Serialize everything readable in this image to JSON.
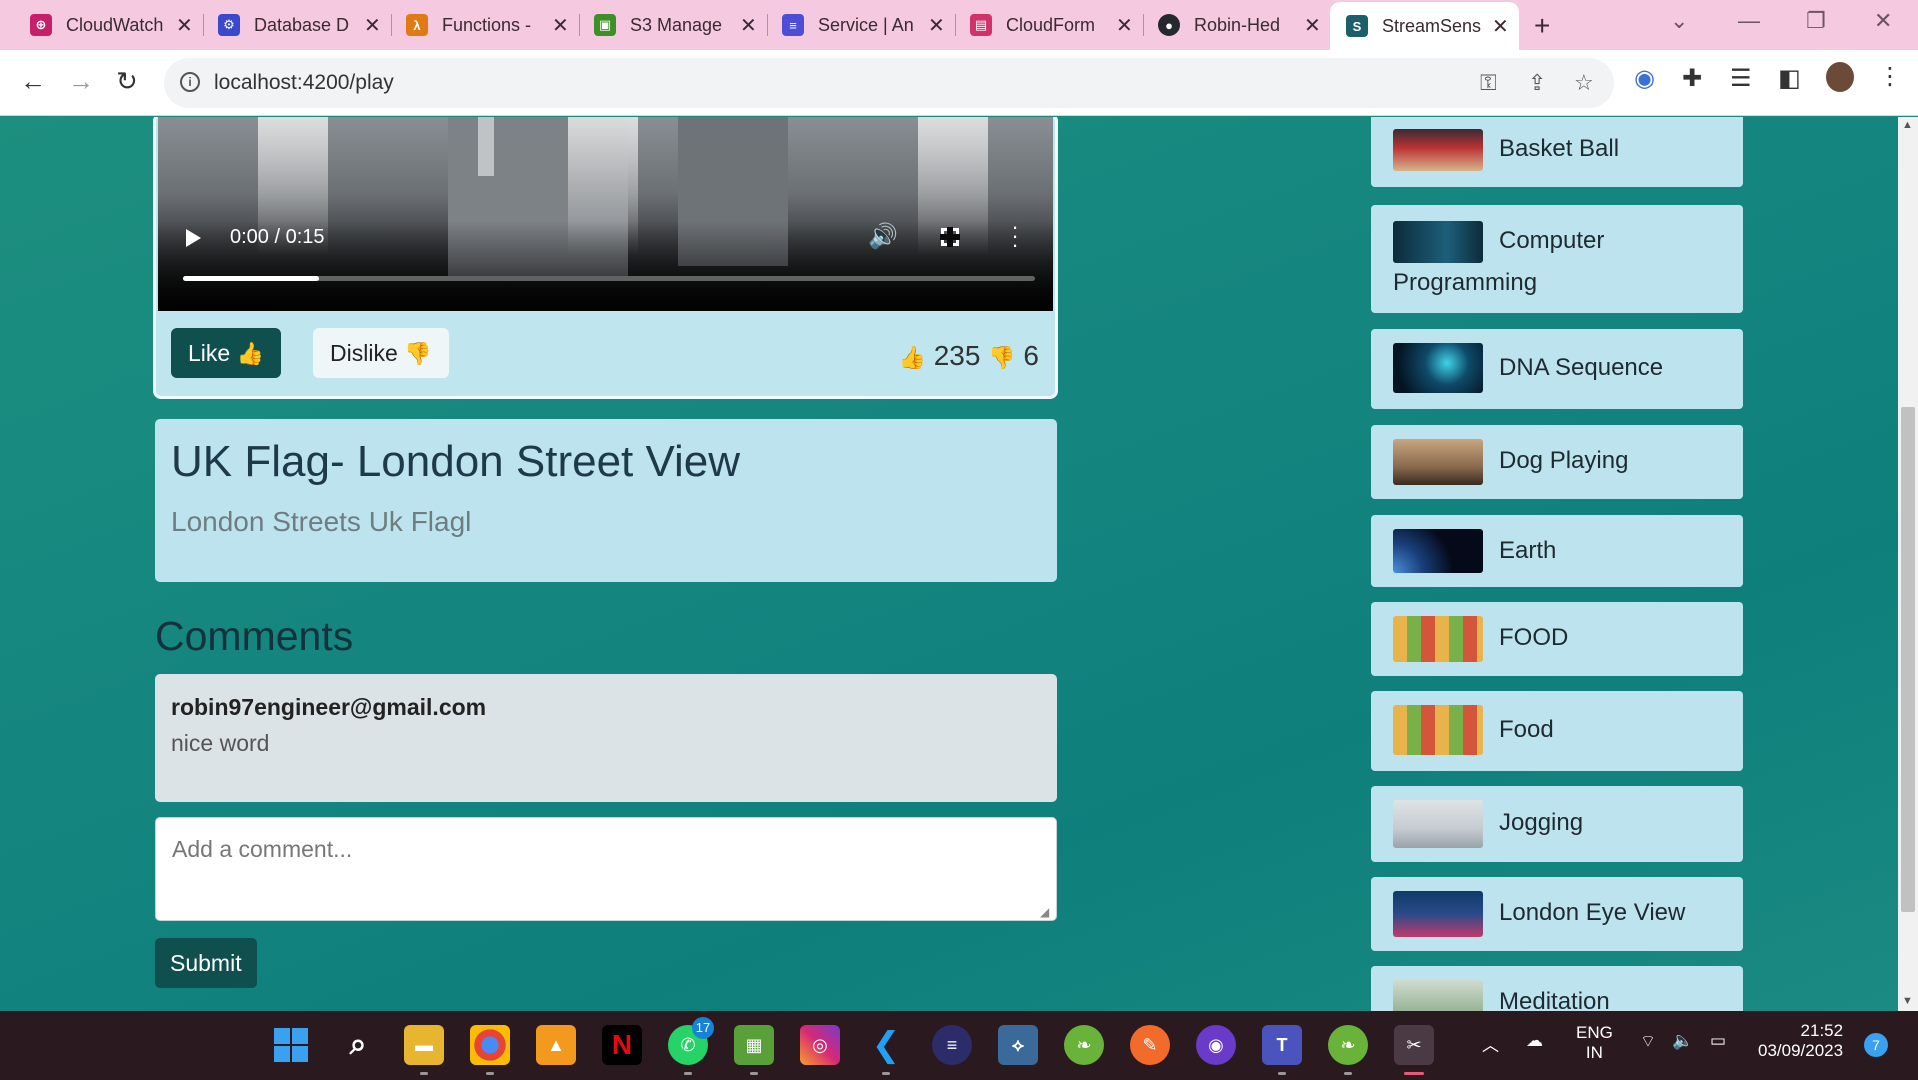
{
  "browser": {
    "tabs": [
      {
        "title": "CloudWatch",
        "icon": "cloudwatch-icon",
        "color": "#c7206b",
        "glyph": "⊕"
      },
      {
        "title": "Database D",
        "icon": "database-icon",
        "color": "#3b48cc",
        "glyph": "⚙"
      },
      {
        "title": "Functions -",
        "icon": "lambda-icon",
        "color": "#e07a14",
        "glyph": "λ"
      },
      {
        "title": "S3 Manage",
        "icon": "s3-icon",
        "color": "#3f8f29",
        "glyph": "▣"
      },
      {
        "title": "Service | An",
        "icon": "service-icon",
        "color": "#4d4dd6",
        "glyph": "≡"
      },
      {
        "title": "CloudForm",
        "icon": "cloudformation-icon",
        "color": "#d13268",
        "glyph": "▤"
      },
      {
        "title": "Robin-Hed",
        "icon": "github-icon",
        "color": "#24292f",
        "glyph": "●"
      },
      {
        "title": "StreamSens",
        "icon": "streamsense-icon",
        "color": "#1a5f6a",
        "glyph": "S"
      }
    ],
    "url": "localhost:4200/play"
  },
  "video": {
    "time": "0:00 / 0:15",
    "progress": 0.16
  },
  "reactions": {
    "like_label": "Like",
    "like_emoji": "👍",
    "dislike_label": "Dislike",
    "dislike_emoji": "👎",
    "like_count": "235",
    "dislike_count": "6"
  },
  "details": {
    "title": "UK Flag- London Street View",
    "description": "London Streets Uk Flagl"
  },
  "comments": {
    "heading": "Comments",
    "items": [
      {
        "author": "robin97engineer@gmail.com",
        "text": "nice word"
      }
    ],
    "placeholder": "Add a comment...",
    "submit_label": "Submit"
  },
  "playlist": [
    {
      "label": "Basket Ball"
    },
    {
      "label": "Computer",
      "label2": "Programming"
    },
    {
      "label": "DNA Sequence"
    },
    {
      "label": "Dog Playing"
    },
    {
      "label": "Earth"
    },
    {
      "label": "FOOD"
    },
    {
      "label": "Food"
    },
    {
      "label": "Jogging"
    },
    {
      "label": "London Eye View"
    },
    {
      "label": "Meditation"
    }
  ],
  "taskbar": {
    "whatsapp_badge": "17",
    "lang": "ENG",
    "region": "IN",
    "time": "21:52",
    "date": "03/09/2023",
    "notifications": "7"
  }
}
